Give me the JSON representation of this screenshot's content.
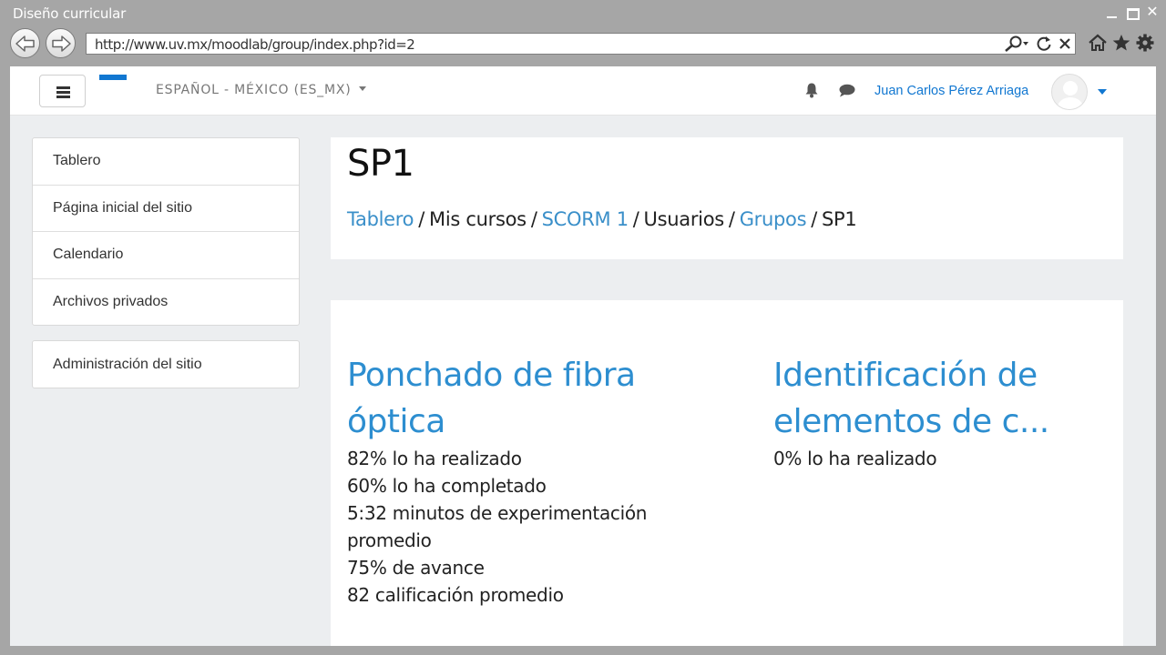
{
  "window": {
    "title": "Diseño curricular"
  },
  "browser": {
    "url": "http://www.uv.mx/moodlab/group/index.php?id=2"
  },
  "navbar": {
    "language": "ESPAÑOL - MÉXICO (ES_MX)",
    "user_name": "Juan Carlos Pérez Arriaga"
  },
  "sidebar": {
    "items": [
      {
        "label": "Tablero"
      },
      {
        "label": "Página inicial del sitio"
      },
      {
        "label": "Calendario"
      },
      {
        "label": "Archivos privados"
      }
    ],
    "admin": {
      "label": "Administración del sitio"
    }
  },
  "header": {
    "title": "SP1",
    "breadcrumb": [
      {
        "label": "Tablero",
        "link": true
      },
      {
        "label": "Mis cursos",
        "link": false
      },
      {
        "label": "SCORM 1",
        "link": true
      },
      {
        "label": "Usuarios",
        "link": false
      },
      {
        "label": "Grupos",
        "link": true
      },
      {
        "label": "SP1",
        "link": false
      }
    ]
  },
  "activities": [
    {
      "title": "Ponchado de fibra óptica",
      "stats": [
        "82% lo ha realizado",
        "60% lo ha completado",
        "5:32 minutos de experimentación promedio",
        "75% de avance",
        "82 calificación promedio"
      ]
    },
    {
      "title": "Identificación de elementos de c...",
      "stats": [
        "0% lo ha realizado"
      ]
    }
  ],
  "colors": {
    "link": "#3a8fc9",
    "accent": "#1177d1",
    "background": "#eceef0"
  }
}
